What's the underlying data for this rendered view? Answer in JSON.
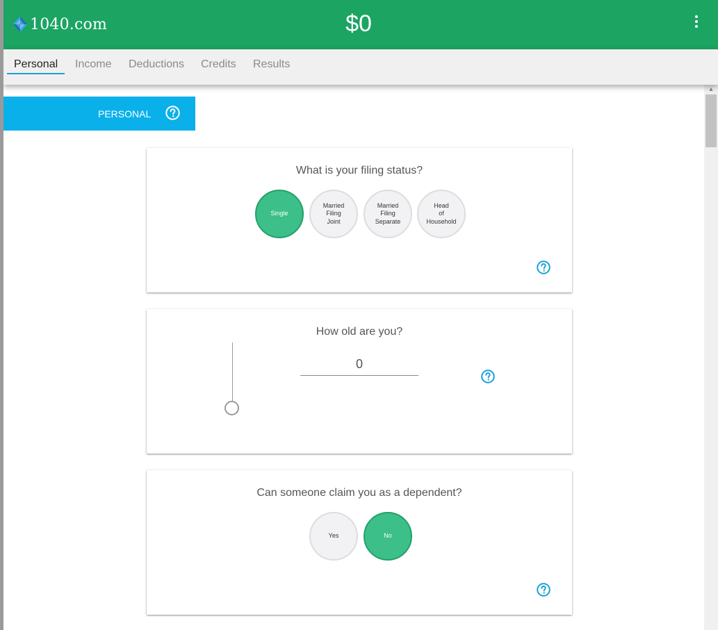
{
  "header": {
    "logo_text": "1040.com",
    "refund_amount": "$0",
    "brand_color": "#1ca463",
    "menu_icon": "vertical-dots-icon"
  },
  "tabs": [
    {
      "label": "Personal",
      "active": true
    },
    {
      "label": "Income",
      "active": false
    },
    {
      "label": "Deductions",
      "active": false
    },
    {
      "label": "Credits",
      "active": false
    },
    {
      "label": "Results",
      "active": false
    }
  ],
  "section": {
    "title": "PERSONAL",
    "color": "#0ab0ea",
    "help_icon": "question-circle-icon"
  },
  "filing_status": {
    "question": "What is your filing status?",
    "options": [
      {
        "label": "Single",
        "selected": true
      },
      {
        "label": "Married\nFiling\nJoint",
        "selected": false
      },
      {
        "label": "Married\nFiling\nSeparate",
        "selected": false
      },
      {
        "label": "Head\nof\nHousehold",
        "selected": false
      }
    ]
  },
  "age": {
    "question": "How old are you?",
    "value": "0",
    "slider_value": 0
  },
  "dependent": {
    "question": "Can someone claim you as a dependent?",
    "options": [
      {
        "label": "Yes",
        "selected": false
      },
      {
        "label": "No",
        "selected": true
      }
    ]
  },
  "colors": {
    "selected_option": "#3cbf88",
    "help_icon": "#1aa0d8"
  }
}
